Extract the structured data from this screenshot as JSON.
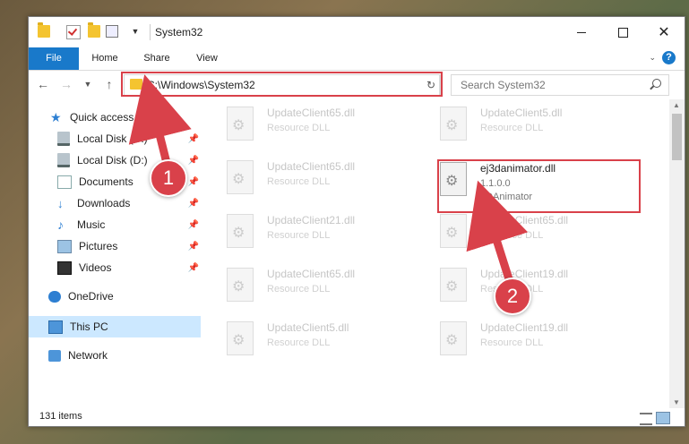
{
  "window": {
    "title": "System32"
  },
  "ribbon": {
    "tabs": [
      "File",
      "Home",
      "Share",
      "View"
    ]
  },
  "nav": {
    "address": "C:\\Windows\\System32",
    "search_placeholder": "Search System32"
  },
  "sidebar": {
    "items": [
      {
        "label": "Quick access",
        "icon": "star-icon",
        "pinned": false
      },
      {
        "label": "Local Disk (C:)",
        "icon": "drive-icon",
        "pinned": true
      },
      {
        "label": "Local Disk (D:)",
        "icon": "drive-icon",
        "pinned": true
      },
      {
        "label": "Documents",
        "icon": "document-icon",
        "pinned": true
      },
      {
        "label": "Downloads",
        "icon": "download-icon",
        "pinned": true
      },
      {
        "label": "Music",
        "icon": "music-icon",
        "pinned": true
      },
      {
        "label": "Pictures",
        "icon": "picture-icon",
        "pinned": true
      },
      {
        "label": "Videos",
        "icon": "video-icon",
        "pinned": true
      },
      {
        "label": "OneDrive",
        "icon": "cloud-icon",
        "pinned": false
      },
      {
        "label": "This PC",
        "icon": "computer-icon",
        "pinned": false
      },
      {
        "label": "Network",
        "icon": "network-icon",
        "pinned": false
      }
    ],
    "selected": "This PC"
  },
  "files": {
    "left_column": [
      {
        "name": "UpdateClient65.dll",
        "desc": "Resource DLL"
      },
      {
        "name": "UpdateClient65.dll",
        "desc": "Resource DLL"
      },
      {
        "name": "UpdateClient21.dll",
        "desc": "Resource DLL"
      },
      {
        "name": "UpdateClient65.dll",
        "desc": "Resource DLL"
      },
      {
        "name": "UpdateClient5.dll",
        "desc": "Resource DLL"
      }
    ],
    "right_column": [
      {
        "name": "UpdateClient5.dll",
        "desc": "Resource DLL"
      },
      {
        "name": "UpdateClient65.dll",
        "desc": "Resource DLL"
      },
      {
        "name": "UpdateClient19.dll",
        "desc": "Resource DLL"
      },
      {
        "name": "UpdateClient19.dll",
        "desc": "Resource DLL"
      }
    ],
    "highlighted": {
      "name": "ej3danimator.dll",
      "version": "1.1.0.0",
      "company": "3DAnimator"
    }
  },
  "status": {
    "item_count": "131 items"
  },
  "callouts": {
    "one": "1",
    "two": "2"
  },
  "colors": {
    "accent": "#1979ca",
    "highlight": "#d9414a",
    "selection": "#cce8ff"
  }
}
